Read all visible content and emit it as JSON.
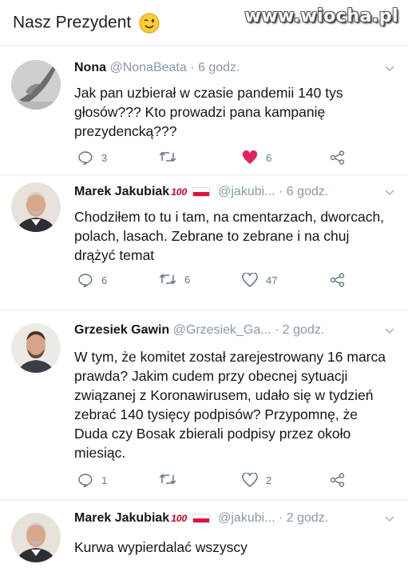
{
  "header": {
    "title": "Nasz Prezydent",
    "emoji_icon": "winking-face-icon",
    "watermark": "www.wiocha.pl"
  },
  "tweets": [
    {
      "name": "Nona",
      "handle": "@NonaBeata",
      "time": "· 6 godz.",
      "text": "Jak pan uzbierał w czasie pandemii 140 tys głosów??? Kto prowadzi pana kampanię prezydencką???",
      "replies": "3",
      "retweets": "",
      "likes": "6",
      "liked": true
    },
    {
      "name": "Marek Jakubiak",
      "badge": "100",
      "handle": "@jakubi...",
      "time": "· 6 godz.",
      "text": "Chodziłem to tu i tam, na cmentarzach, dworcach, polach, lasach. Zebrane to zebrane i na chuj drążyć temat",
      "replies": "6",
      "retweets": "6",
      "likes": "47",
      "liked": false
    },
    {
      "name": "Grzesiek Gawin",
      "handle": "@Grzesiek_Ga...",
      "time": "· 2 godz.",
      "text": "W tym, że komitet został zarejestrowany 16 marca prawda? Jakim cudem przy obecnej sytuacji związanej z Koronawirusem, udało się w tydzień zebrać 140 tysięcy podpisów? Przypomnę, że Duda czy Bosak zbierali podpisy przez około miesiąc.",
      "replies": "1",
      "retweets": "",
      "likes": "2",
      "liked": false
    },
    {
      "name": "Marek Jakubiak",
      "badge": "100",
      "handle": "@jakubi...",
      "time": "· 2 godz.",
      "text": "Kurwa wypierdalać wszyscy"
    }
  ],
  "colors": {
    "like_red": "#e0245e",
    "grey": "#657786",
    "handle": "#8899a6",
    "flag_red": "#dc143c"
  }
}
